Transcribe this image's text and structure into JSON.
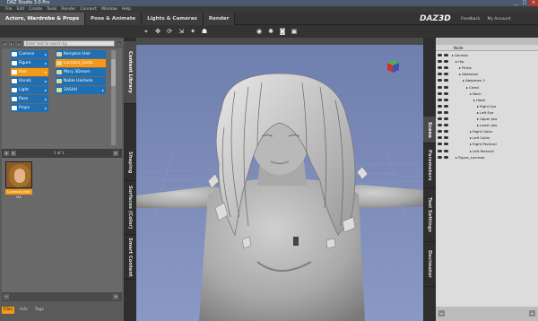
{
  "window": {
    "title": "DAZ Studio 3.0 Pro",
    "controls": {
      "minimize": "_",
      "maximize": "□",
      "close": "×"
    }
  },
  "menubar": [
    "File",
    "Edit",
    "Create",
    "Tools",
    "Render",
    "Connect",
    "Window",
    "Help"
  ],
  "tabs": [
    {
      "label": "Actors, Wardrobe & Props",
      "active": true
    },
    {
      "label": "Pose & Animate",
      "active": false
    },
    {
      "label": "Lights & Cameras",
      "active": false
    },
    {
      "label": "Render",
      "active": false
    }
  ],
  "brand": {
    "logo_text": "DAZ",
    "logo_suffix": "3D"
  },
  "top_links": [
    "Feedback",
    "My Account"
  ],
  "toolbar_icons": [
    "select-icon",
    "translate-icon",
    "rotate-icon",
    "scale-icon",
    "universal-icon",
    "node-icon"
  ],
  "toolbar_icons_right": [
    "render-icon",
    "spotlight-icon",
    "camera-icon",
    "viewport-icon"
  ],
  "content_library": {
    "search_placeholder": "Enter text to search by",
    "categories": [
      {
        "label": "Camera",
        "selected": false
      },
      {
        "label": "Figure",
        "selected": false
      },
      {
        "label": "Hair",
        "selected": true
      },
      {
        "label": "Hands",
        "selected": false
      },
      {
        "label": "Light",
        "selected": false
      },
      {
        "label": "Pose",
        "selected": false
      },
      {
        "label": "Props",
        "selected": false
      }
    ],
    "subcategories": [
      {
        "label": "Kempton Hair",
        "selected": false
      },
      {
        "label": "Lucrezia_Locks",
        "selected": true
      },
      {
        "label": "Mary 3Dream",
        "selected": false
      },
      {
        "label": "Noble Hairbelo",
        "selected": false
      },
      {
        "label": "SASAH",
        "selected": false
      }
    ],
    "page_indicator": "1 of 1",
    "items": [
      {
        "label": "Lucrezia_Hair H1"
      }
    ],
    "bottom_tabs": [
      {
        "label": "Files",
        "active": true
      },
      {
        "label": "Info",
        "active": false
      },
      {
        "label": "Tags",
        "active": false
      }
    ]
  },
  "left_vertical_tabs": [
    {
      "label": "Content Library",
      "active": true
    },
    {
      "label": "Shaping",
      "active": false
    },
    {
      "label": "Surfaces (Color)",
      "active": false
    },
    {
      "label": "Smart Content",
      "active": false
    }
  ],
  "right_vertical_tabs": [
    {
      "label": "Scene",
      "active": true
    },
    {
      "label": "Parameters",
      "active": false
    },
    {
      "label": "Tool Settings",
      "active": false
    },
    {
      "label": "Decimator",
      "active": false
    }
  ],
  "scene": {
    "header": "Node",
    "nodes": [
      {
        "label": "Genesis",
        "depth": 0
      },
      {
        "label": "Hip",
        "depth": 1
      },
      {
        "label": "Pelvis",
        "depth": 2
      },
      {
        "label": "Abdomen",
        "depth": 2
      },
      {
        "label": "Abdomen 2",
        "depth": 3
      },
      {
        "label": "Chest",
        "depth": 4
      },
      {
        "label": "Neck",
        "depth": 5
      },
      {
        "label": "Head",
        "depth": 6
      },
      {
        "label": "Right Eye",
        "depth": 7
      },
      {
        "label": "Left Eye",
        "depth": 7
      },
      {
        "label": "Upper Jaw",
        "depth": 7
      },
      {
        "label": "Lower Jaw",
        "depth": 7
      },
      {
        "label": "Right Collar",
        "depth": 5
      },
      {
        "label": "Left Collar",
        "depth": 5
      },
      {
        "label": "Right Pectoral",
        "depth": 5
      },
      {
        "label": "Left Pectoral",
        "depth": 5
      },
      {
        "label": "Figure_Lucrezia",
        "depth": 1
      }
    ]
  },
  "colors": {
    "accent_orange": "#f39b17",
    "accent_blue": "#1e6fb3",
    "viewport_bg": "#7786b2"
  }
}
